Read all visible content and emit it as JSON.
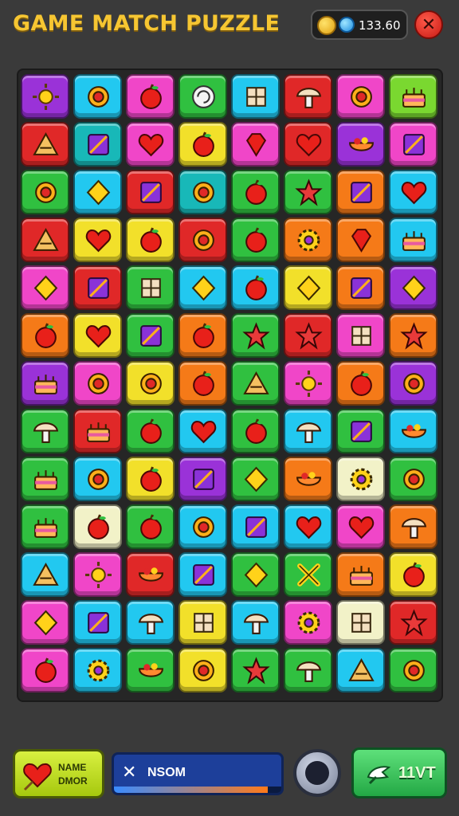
{
  "header": {
    "title": "GAME MATCH PUZZLE",
    "currency_value": "133.60"
  },
  "colors": {
    "title": "#f6c632",
    "board_bg": "#262626",
    "close_button": "#e0281e"
  },
  "board": {
    "rows": 13,
    "columns": 8,
    "tiles": [
      [
        {
          "color": "#9a32d8",
          "icon": "sun-icon"
        },
        {
          "color": "#22c8f0",
          "icon": "ring-icon"
        },
        {
          "color": "#f046c8",
          "icon": "apple-icon"
        },
        {
          "color": "#30c040",
          "icon": "swirl-icon"
        },
        {
          "color": "#22c8f0",
          "icon": "cube-icon"
        },
        {
          "color": "#e02828",
          "icon": "mushroom-icon"
        },
        {
          "color": "#f046c8",
          "icon": "ring-icon"
        },
        {
          "color": "#7ad830",
          "icon": "cake-icon"
        }
      ],
      [
        {
          "color": "#e02828",
          "icon": "triangle-icon"
        },
        {
          "color": "#18b8b8",
          "icon": "square-icon"
        },
        {
          "color": "#f046c8",
          "icon": "heart-icon"
        },
        {
          "color": "#f2e02a",
          "icon": "apple-icon"
        },
        {
          "color": "#f046c8",
          "icon": "gem-icon"
        },
        {
          "color": "#e02828",
          "icon": "heart-icon"
        },
        {
          "color": "#9a32d8",
          "icon": "bowl-icon"
        },
        {
          "color": "#f046c8",
          "icon": "square-icon"
        }
      ],
      [
        {
          "color": "#30c040",
          "icon": "ring-icon"
        },
        {
          "color": "#22c8f0",
          "icon": "diamond-icon"
        },
        {
          "color": "#e02828",
          "icon": "square-icon"
        },
        {
          "color": "#18b8b8",
          "icon": "ring-icon"
        },
        {
          "color": "#30c040",
          "icon": "apple-icon"
        },
        {
          "color": "#30c040",
          "icon": "star-icon"
        },
        {
          "color": "#f57a18",
          "icon": "square-icon"
        },
        {
          "color": "#22c8f0",
          "icon": "heart-icon"
        }
      ],
      [
        {
          "color": "#e02828",
          "icon": "triangle-icon"
        },
        {
          "color": "#f2e02a",
          "icon": "heart-icon"
        },
        {
          "color": "#f2e02a",
          "icon": "apple-icon"
        },
        {
          "color": "#e02828",
          "icon": "ring-icon"
        },
        {
          "color": "#30c040",
          "icon": "apple-icon"
        },
        {
          "color": "#f57a18",
          "icon": "gear-icon"
        },
        {
          "color": "#f57a18",
          "icon": "gem-icon"
        },
        {
          "color": "#22c8f0",
          "icon": "cake-icon"
        }
      ],
      [
        {
          "color": "#f046c8",
          "icon": "diamond-icon"
        },
        {
          "color": "#e02828",
          "icon": "square-icon"
        },
        {
          "color": "#30c040",
          "icon": "cube-icon"
        },
        {
          "color": "#22c8f0",
          "icon": "diamond-icon"
        },
        {
          "color": "#22c8f0",
          "icon": "apple-icon"
        },
        {
          "color": "#f2e02a",
          "icon": "diamond-icon"
        },
        {
          "color": "#f57a18",
          "icon": "square-icon"
        },
        {
          "color": "#9a32d8",
          "icon": "diamond-icon"
        }
      ],
      [
        {
          "color": "#f57a18",
          "icon": "apple-icon"
        },
        {
          "color": "#f2e02a",
          "icon": "heart-icon"
        },
        {
          "color": "#30c040",
          "icon": "square-icon"
        },
        {
          "color": "#f57a18",
          "icon": "apple-icon"
        },
        {
          "color": "#30c040",
          "icon": "star-icon"
        },
        {
          "color": "#e02828",
          "icon": "star-icon"
        },
        {
          "color": "#f046c8",
          "icon": "cube-icon"
        },
        {
          "color": "#f57a18",
          "icon": "star-icon"
        }
      ],
      [
        {
          "color": "#9a32d8",
          "icon": "cake-icon"
        },
        {
          "color": "#f046c8",
          "icon": "ring-icon"
        },
        {
          "color": "#f2e02a",
          "icon": "ring-icon"
        },
        {
          "color": "#f57a18",
          "icon": "apple-icon"
        },
        {
          "color": "#30c040",
          "icon": "triangle-icon"
        },
        {
          "color": "#f046c8",
          "icon": "sun-icon"
        },
        {
          "color": "#f57a18",
          "icon": "apple-icon"
        },
        {
          "color": "#9a32d8",
          "icon": "ring-icon"
        }
      ],
      [
        {
          "color": "#30c040",
          "icon": "mushroom-icon"
        },
        {
          "color": "#e02828",
          "icon": "cake-icon"
        },
        {
          "color": "#30c040",
          "icon": "apple-icon"
        },
        {
          "color": "#22c8f0",
          "icon": "heart-icon"
        },
        {
          "color": "#30c040",
          "icon": "apple-icon"
        },
        {
          "color": "#22c8f0",
          "icon": "mushroom-icon"
        },
        {
          "color": "#30c040",
          "icon": "square-icon"
        },
        {
          "color": "#22c8f0",
          "icon": "bowl-icon"
        }
      ],
      [
        {
          "color": "#30c040",
          "icon": "cake-icon"
        },
        {
          "color": "#22c8f0",
          "icon": "ring-icon"
        },
        {
          "color": "#f2e02a",
          "icon": "apple-icon"
        },
        {
          "color": "#9a32d8",
          "icon": "square-icon"
        },
        {
          "color": "#30c040",
          "icon": "diamond-icon"
        },
        {
          "color": "#f57a18",
          "icon": "bowl-icon"
        },
        {
          "color": "#f2f2c8",
          "icon": "gear-icon"
        },
        {
          "color": "#30c040",
          "icon": "ring-icon"
        }
      ],
      [
        {
          "color": "#30c040",
          "icon": "cake-icon"
        },
        {
          "color": "#f2f2c8",
          "icon": "apple-icon"
        },
        {
          "color": "#30c040",
          "icon": "apple-icon"
        },
        {
          "color": "#22c8f0",
          "icon": "ring-icon"
        },
        {
          "color": "#22c8f0",
          "icon": "square-icon"
        },
        {
          "color": "#22c8f0",
          "icon": "heart-icon"
        },
        {
          "color": "#f046c8",
          "icon": "heart-icon"
        },
        {
          "color": "#f57a18",
          "icon": "mushroom-icon"
        }
      ],
      [
        {
          "color": "#22c8f0",
          "icon": "triangle-icon"
        },
        {
          "color": "#f046c8",
          "icon": "sun-icon"
        },
        {
          "color": "#e02828",
          "icon": "bowl-icon"
        },
        {
          "color": "#22c8f0",
          "icon": "square-icon"
        },
        {
          "color": "#30c040",
          "icon": "diamond-icon"
        },
        {
          "color": "#30c040",
          "icon": "cross-icon"
        },
        {
          "color": "#f57a18",
          "icon": "cake-icon"
        },
        {
          "color": "#f2e02a",
          "icon": "apple-icon"
        }
      ],
      [
        {
          "color": "#f046c8",
          "icon": "diamond-icon"
        },
        {
          "color": "#22c8f0",
          "icon": "square-icon"
        },
        {
          "color": "#22c8f0",
          "icon": "mushroom-icon"
        },
        {
          "color": "#f2e02a",
          "icon": "cube-icon"
        },
        {
          "color": "#22c8f0",
          "icon": "mushroom-icon"
        },
        {
          "color": "#f046c8",
          "icon": "gear-icon"
        },
        {
          "color": "#f2f2c8",
          "icon": "cube-icon"
        },
        {
          "color": "#e02828",
          "icon": "star-icon"
        }
      ],
      [
        {
          "color": "#f046c8",
          "icon": "apple-icon"
        },
        {
          "color": "#22c8f0",
          "icon": "gear-icon"
        },
        {
          "color": "#30c040",
          "icon": "bowl-icon"
        },
        {
          "color": "#f2e02a",
          "icon": "ring-icon"
        },
        {
          "color": "#30c040",
          "icon": "star-icon"
        },
        {
          "color": "#30c040",
          "icon": "mushroom-icon"
        },
        {
          "color": "#22c8f0",
          "icon": "triangle-icon"
        },
        {
          "color": "#30c040",
          "icon": "ring-icon"
        }
      ]
    ]
  },
  "bottom_bar": {
    "left_button_label": "NAME DMOR",
    "progress_label": "NSOM",
    "progress_fraction": 0.92,
    "right_button_label": "11VT"
  }
}
